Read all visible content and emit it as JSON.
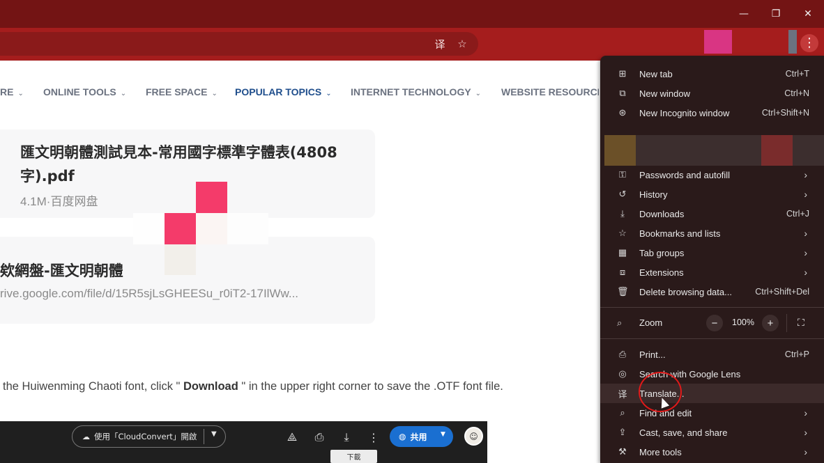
{
  "window": {
    "minimize_icon": "—",
    "restore_icon": "❐",
    "close_icon": "✕"
  },
  "omnibox": {
    "translate_icon": "译",
    "star_icon": "☆"
  },
  "nav": {
    "items": [
      {
        "label": "RE"
      },
      {
        "label": "ONLINE TOOLS"
      },
      {
        "label": "FREE SPACE"
      },
      {
        "label": "POPULAR TOPICS"
      },
      {
        "label": "INTERNET TECHNOLOGY"
      },
      {
        "label": "WEBSITE RESOURCES"
      }
    ],
    "chevron": "⌄"
  },
  "cards": [
    {
      "title_line1": "匯文明朝體測試見本-常用國字標準字體表(4808",
      "title_line2": "字).pdf",
      "subtitle": "4.1M·百度网盘"
    },
    {
      "title": "欸網盤-匯文明朝體",
      "subtitle": "rive.google.com/file/d/15R5sjLsGHEESu_r0iT2-17IlWw..."
    }
  ],
  "paragraph": {
    "before": "the Huiwenming Chaoti font, click \" ",
    "bold": "Download",
    "after": " \" in the upper right corner to save the .OTF font file."
  },
  "doc_toolbar": {
    "cloudconvert_label": "使用「CloudConvert」開啟",
    "share_label": "共用",
    "tooltip": "下載",
    "avatar_glyph": "☺"
  },
  "menu": {
    "group1": [
      {
        "label": "New tab",
        "shortcut": "Ctrl+T",
        "icon": "⊞"
      },
      {
        "label": "New window",
        "shortcut": "Ctrl+N",
        "icon": "⧉"
      },
      {
        "label": "New Incognito window",
        "shortcut": "Ctrl+Shift+N",
        "icon": "⊛"
      }
    ],
    "group2": [
      {
        "label": "Passwords and autofill",
        "icon": "⚿"
      },
      {
        "label": "History",
        "icon": "↺"
      },
      {
        "label": "Downloads",
        "shortcut": "Ctrl+J",
        "icon": "⤓"
      },
      {
        "label": "Bookmarks and lists",
        "icon": "☆"
      },
      {
        "label": "Tab groups",
        "icon": "▦"
      },
      {
        "label": "Extensions",
        "icon": "⧈"
      },
      {
        "label": "Delete browsing data...",
        "shortcut": "Ctrl+Shift+Del",
        "icon": "🗑"
      }
    ],
    "zoom": {
      "label": "Zoom",
      "value": "100%",
      "minus": "−",
      "plus": "+",
      "icon": "⌕",
      "fullscreen_icon": "⛶"
    },
    "group3": [
      {
        "label": "Print...",
        "shortcut": "Ctrl+P",
        "icon": "⎙"
      },
      {
        "label": "Search with Google Lens",
        "icon": "◎"
      },
      {
        "label": "Translate...",
        "icon": "译"
      },
      {
        "label": "Find and edit",
        "icon": "⌕"
      },
      {
        "label": "Cast, save, and share",
        "icon": "⇪"
      },
      {
        "label": "More tools",
        "icon": "⚒"
      }
    ],
    "arrow": "›"
  }
}
